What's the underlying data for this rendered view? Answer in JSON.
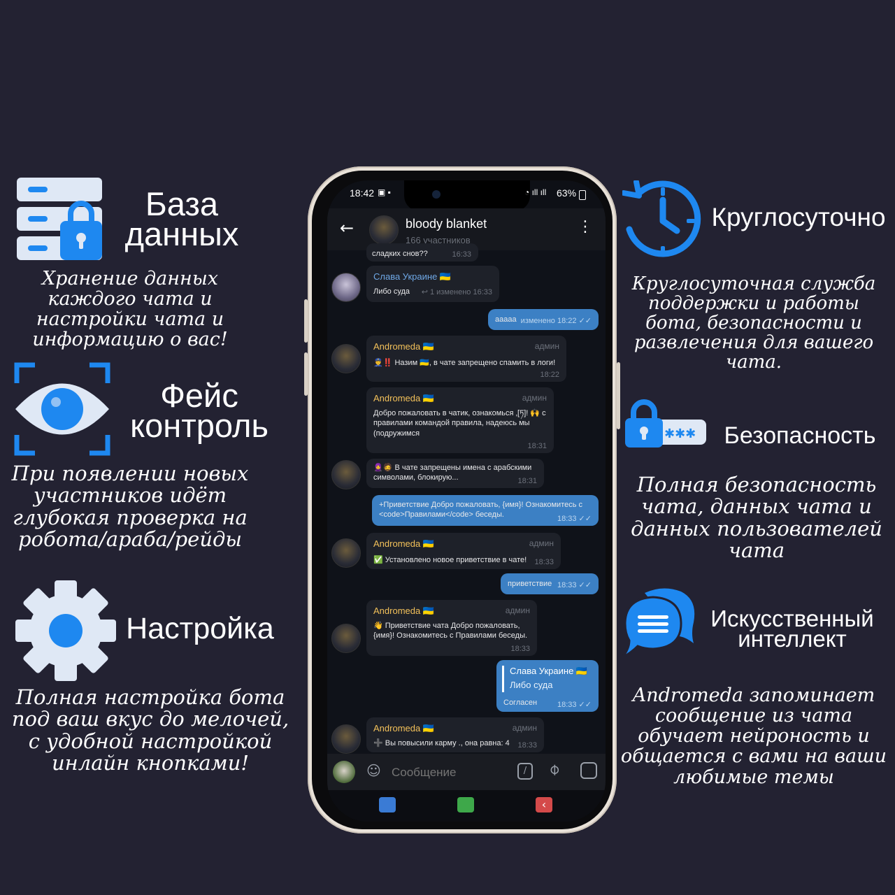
{
  "features": {
    "database": {
      "title_line1": "База",
      "title_line2": "данных",
      "description": "Хранение данных каждого чата и настройки чата и информацию о вас!"
    },
    "face_control": {
      "title_line1": "Фейс",
      "title_line2": "контроль",
      "description": "При появлении новых участников идёт глубокая проверка на робота/араба/рейды"
    },
    "settings": {
      "title": "Настройка",
      "description": "Полная настройка бота под ваш вкус до мелочей, с удобной настройкой инлайн кнопками!"
    },
    "round_clock": {
      "title": "Круглосуточно",
      "description": "Круглосуточная служба поддержки и работы бота, безопасности и развлечения для вашего чата."
    },
    "security": {
      "title": "Безопасность",
      "description": "Полная безопасность чата, данных чата и данных пользователей чата"
    },
    "ai": {
      "title_line1": "Искусственный",
      "title_line2": "интеллект",
      "description": "Andromeda запоминает сообщение из чата обучает нейроность и общается с вами на ваши любимые темы"
    }
  },
  "colors": {
    "background": "#232232",
    "accent": "#1e88f0",
    "icon_light": "#dfe8f5",
    "bubble_in": "#1e2129",
    "bubble_out": "#3c80c4",
    "sender": "#f3c15a"
  },
  "phone": {
    "status": {
      "time": "18:42",
      "battery": "63%"
    },
    "chat": {
      "title": "bloody blanket",
      "subtitle": "166 участников"
    },
    "messages": [
      {
        "text": "сладких снов??",
        "time": "16:33"
      },
      {
        "sender": "Слава Украине 🇺🇦",
        "text": "Либо суда",
        "meta": "↩ 1  изменено 16:33"
      },
      {
        "text": "ааааа",
        "meta": "изменено 18:22 ✓✓"
      },
      {
        "sender": "Andromeda 🇺🇦",
        "badge": "админ",
        "text": "👮‼️ Назим 🇺🇦, в чате запрещено спамить в логи!",
        "time": "18:22"
      },
      {
        "sender": "Andromeda 🇺🇦",
        "badge": "админ",
        "text": "Добро пожаловать в чатик, ознакомься ‚[ཏ]! 🙌 с правилами командой правила, надеюсь мы (подружимся",
        "time": "18:31"
      },
      {
        "text": "🧕🧔 В чате запрещены имена с арабскими символами, блокирую...",
        "time": "18:31"
      },
      {
        "text": "+Приветствие Добро пожаловать, {имя}! Ознакомитесь с <code>Правилами</code> беседы.",
        "time": "18:33 ✓✓"
      },
      {
        "sender": "Andromeda 🇺🇦",
        "badge": "админ",
        "text": "✅ Установлено новое приветствие в чате!",
        "time": "18:33"
      },
      {
        "text": "приветствие",
        "time": "18:33 ✓✓"
      },
      {
        "sender": "Andromeda 🇺🇦",
        "badge": "админ",
        "text": "👋 Приветствие чата Добро пожаловать, {имя}! Ознакомитесь с Правилами беседы.",
        "time": "18:33"
      },
      {
        "quote_sender": "Слава Украине 🇺🇦",
        "quote_text": "Либо суда",
        "text": "Согласен",
        "time": "18:33 ✓✓"
      },
      {
        "sender": "Andromeda 🇺🇦",
        "badge": "админ",
        "text": "➕ Вы повысили карму ., она равна: 4",
        "time": "18:33"
      }
    ],
    "composer": {
      "placeholder": "Сообщение"
    }
  }
}
